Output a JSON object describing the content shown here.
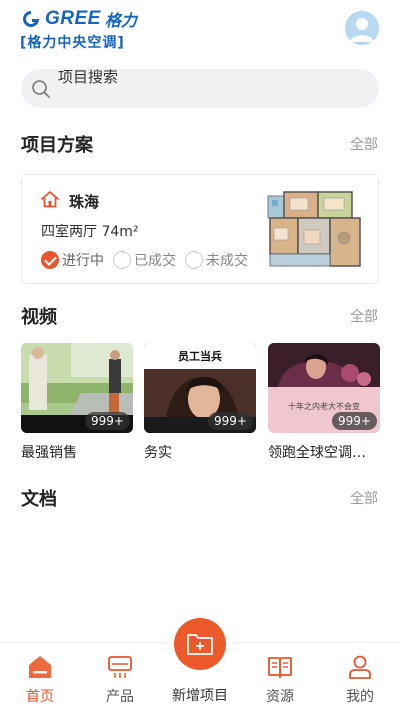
{
  "header": {
    "logo_word": "GREE",
    "logo_cn": "格力",
    "logo_sub": "[格力中央空调]"
  },
  "search": {
    "placeholder": "项目搜索"
  },
  "projects": {
    "title": "项目方案",
    "more": "全部",
    "card": {
      "city": "珠海",
      "desc": "四室两厅  74m²",
      "statuses": [
        {
          "label": "进行中",
          "checked": true
        },
        {
          "label": "已成交",
          "checked": false
        },
        {
          "label": "未成交",
          "checked": false
        }
      ]
    }
  },
  "videos": {
    "title": "视频",
    "more": "全部",
    "items": [
      {
        "title": "最强销售",
        "views": "999+"
      },
      {
        "title": "务实",
        "views": "999+",
        "overlay_title": "员工当兵"
      },
      {
        "title": "领跑全球空调…",
        "views": "999+",
        "overlay_text": "十年之内老大不会变"
      }
    ]
  },
  "documents": {
    "title": "文档",
    "more": "全部"
  },
  "bottom_nav": {
    "items": [
      {
        "label": "首页",
        "icon": "home-icon",
        "active": true
      },
      {
        "label": "产品",
        "icon": "air-conditioner-icon",
        "active": false
      },
      {
        "label": "新增项目",
        "icon": "add-folder-icon",
        "active": false
      },
      {
        "label": "资源",
        "icon": "book-icon",
        "active": false
      },
      {
        "label": "我的",
        "icon": "user-icon",
        "active": false
      }
    ]
  },
  "colors": {
    "accent": "#e8542d",
    "brand": "#1565c0"
  }
}
